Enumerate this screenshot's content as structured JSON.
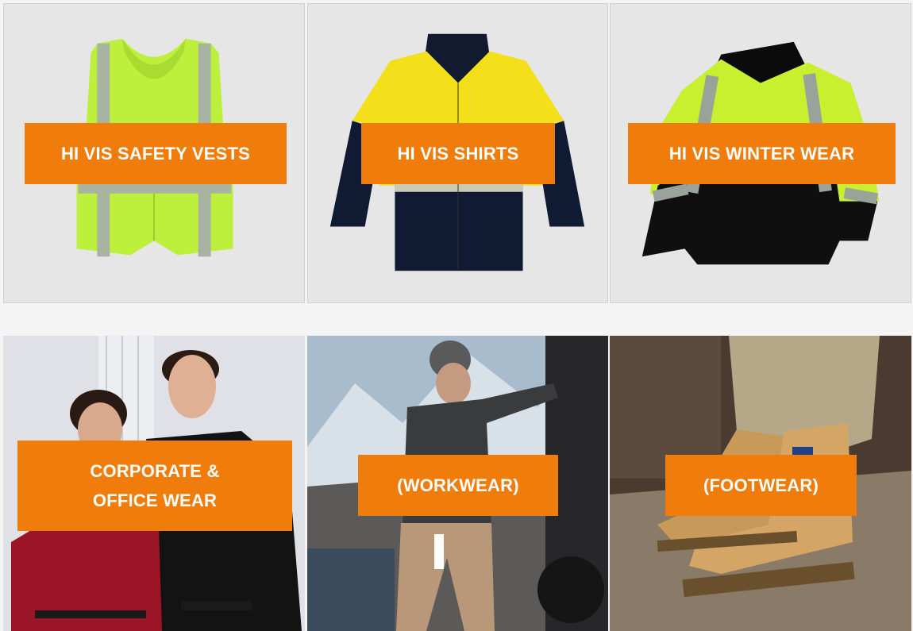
{
  "categories": [
    {
      "label": "HI VIS SAFETY VESTS",
      "image": "hi-vis-safety-vest-photo"
    },
    {
      "label": "HI VIS SHIRTS",
      "image": "hi-vis-shirt-photo"
    },
    {
      "label": "HI VIS WINTER WEAR",
      "image": "hi-vis-winter-jacket-photo"
    },
    {
      "label": "CORPORATE &\nOFFICE WEAR",
      "image": "corporate-office-couple-photo"
    },
    {
      "label": "(WORKWEAR)",
      "image": "worker-with-truck-photo"
    },
    {
      "label": "(FOOTWEAR)",
      "image": "work-boots-photo"
    }
  ],
  "colors": {
    "accent": "#f07c0b",
    "label_text": "#ffffff",
    "tile_bg": "#e6e6e6",
    "page_bg": "#f4f4f4"
  }
}
